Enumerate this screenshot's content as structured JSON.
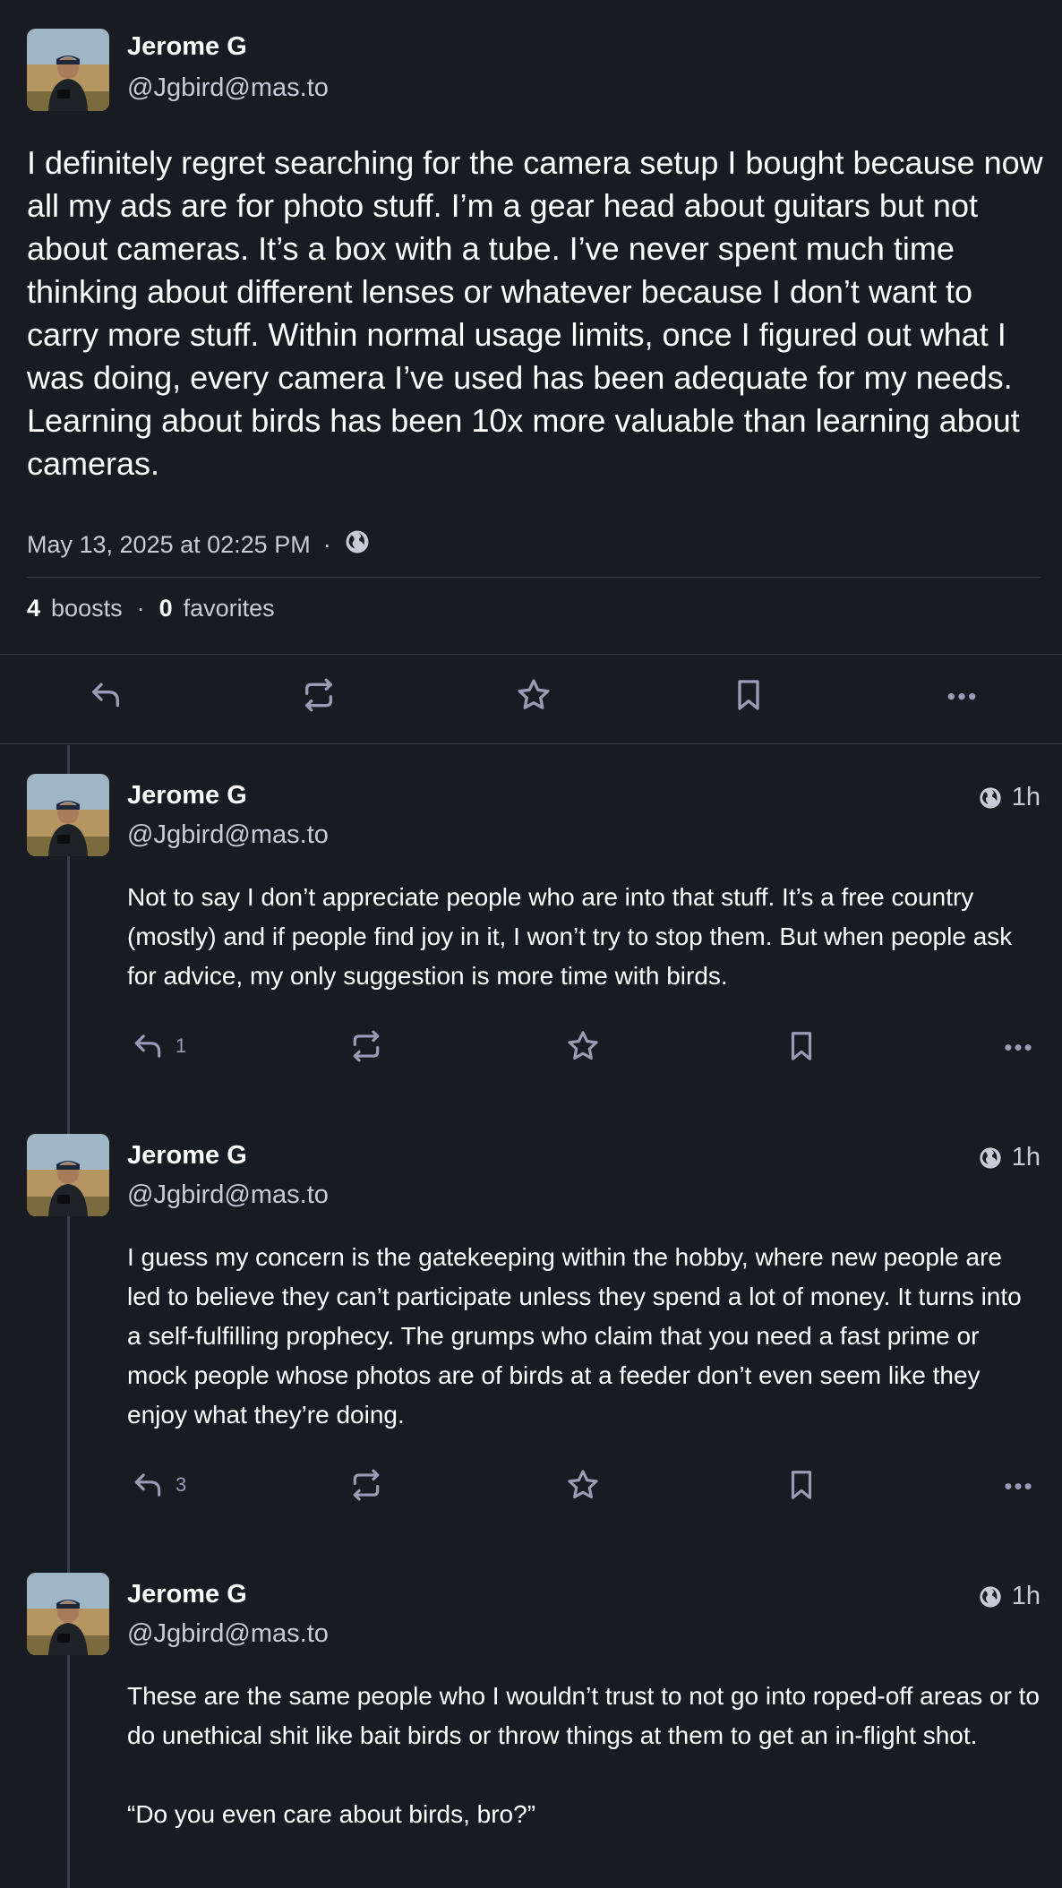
{
  "main_post": {
    "author_name": "Jerome G",
    "author_handle": "@Jgbird@mas.to",
    "text": "I definitely regret searching for the camera setup I bought because now all my ads are for photo stuff. I’m a gear head about guitars but not about cameras. It’s a box with a tube. I’ve never spent much time thinking about different lenses or whatever because I don’t want to carry more stuff. Within normal usage limits, once I figured out what I was doing, every camera I’ve used has been adequate for my needs. Learning about birds has been 10x more valuable than learning about cameras.",
    "timestamp": "May 13, 2025 at 02:25 PM",
    "separator": "·",
    "visibility_icon": "globe-icon",
    "boosts_count": "4",
    "boosts_label": "boosts",
    "favorites_count": "0",
    "favorites_label": "favorites"
  },
  "replies": [
    {
      "author_name": "Jerome G",
      "author_handle": "@Jgbird@mas.to",
      "time": "1h",
      "text": "Not to say I don’t appreciate people who are into that stuff. It’s a free country (mostly) and if people find joy in it, I won’t try to stop them. But when people ask for advice, my only suggestion is more time with birds.",
      "reply_count": "1"
    },
    {
      "author_name": "Jerome G",
      "author_handle": "@Jgbird@mas.to",
      "time": "1h",
      "text": "I guess my concern is the gatekeeping within the hobby, where new people are led to believe they can’t participate unless they spend a lot of money. It turns into a self-fulfilling prophecy. The grumps who claim that you need a fast prime or mock people whose photos are of birds at a feeder don’t even seem like they enjoy what they’re doing.",
      "reply_count": "3"
    },
    {
      "author_name": "Jerome G",
      "author_handle": "@Jgbird@mas.to",
      "time": "1h",
      "text": "These are the same people who I wouldn’t trust to not go into roped-off areas or to do unethical shit like bait birds or throw things at them to get an in-flight shot.\n\n“Do you even care about birds, bro?”",
      "reply_count": ""
    }
  ],
  "colors": {
    "background": "#191b22",
    "text_primary": "#ffffff",
    "text_secondary": "#c9c9d8",
    "icon": "#9a9bb5",
    "divider": "#393a48"
  },
  "icons": [
    "reply-icon",
    "boost-icon",
    "star-icon",
    "bookmark-icon",
    "more-icon",
    "globe-icon"
  ]
}
